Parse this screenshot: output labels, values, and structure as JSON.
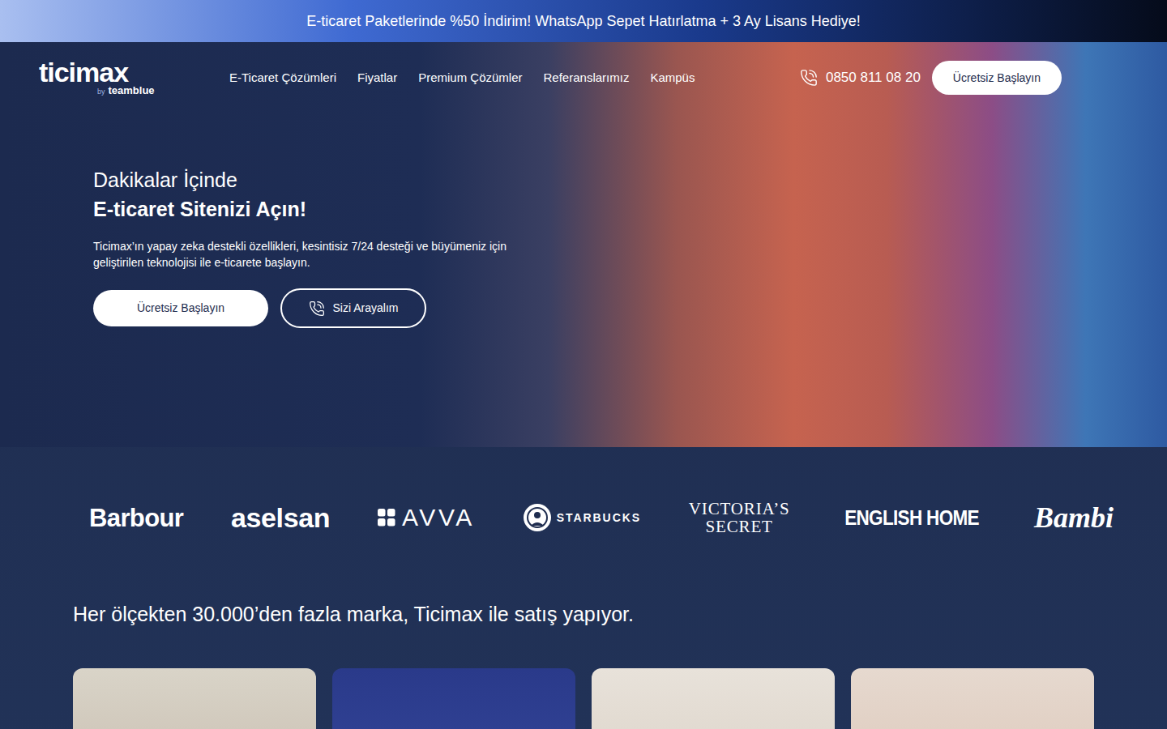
{
  "banner": {
    "text": "E-ticaret Paketlerinde %50 İndirim! WhatsApp Sepet Hatırlatma + 3 Ay Lisans Hediye!"
  },
  "header": {
    "logo": {
      "name": "ticimax",
      "byline": "by",
      "brand": "teamblue"
    },
    "nav": [
      {
        "label": "E-Ticaret Çözümleri"
      },
      {
        "label": "Fiyatlar"
      },
      {
        "label": "Premium Çözümler"
      },
      {
        "label": "Referanslarımız"
      },
      {
        "label": "Kampüs"
      }
    ],
    "phone": "0850 811 08 20",
    "cta": "Ücretsiz Başlayın"
  },
  "hero": {
    "kicker": "Dakikalar İçinde",
    "title": "E-ticaret Sitenizi Açın!",
    "description": "Ticimax’ın yapay zeka destekli özellikleri, kesintisiz 7/24 desteği ve büyümeniz için geliştirilen teknolojisi ile e-ticarete başlayın.",
    "buttons": [
      {
        "label": "Ücretsiz Başlayın",
        "kind": "primary"
      },
      {
        "label": "Sizi Arayalım",
        "kind": "outline"
      }
    ]
  },
  "brands": [
    {
      "lines": [
        "Barbour"
      ],
      "kind": "bold"
    },
    {
      "lines": [
        "aselsan"
      ],
      "kind": "heavy"
    },
    {
      "lines": [
        "AVVA"
      ],
      "kind": "grid"
    },
    {
      "lines": [
        "STARBUCKS"
      ],
      "kind": "siren"
    },
    {
      "lines": [
        "VICTORIA’S",
        "SECRET"
      ],
      "kind": "serif"
    },
    {
      "lines": [
        "ENGLISH HOME"
      ],
      "kind": "condensed"
    },
    {
      "lines": [
        "Bambi"
      ],
      "kind": "script"
    }
  ],
  "tagline": "Her ölçekten 30.000’den fazla marka, Ticimax ile satış yapıyor."
}
